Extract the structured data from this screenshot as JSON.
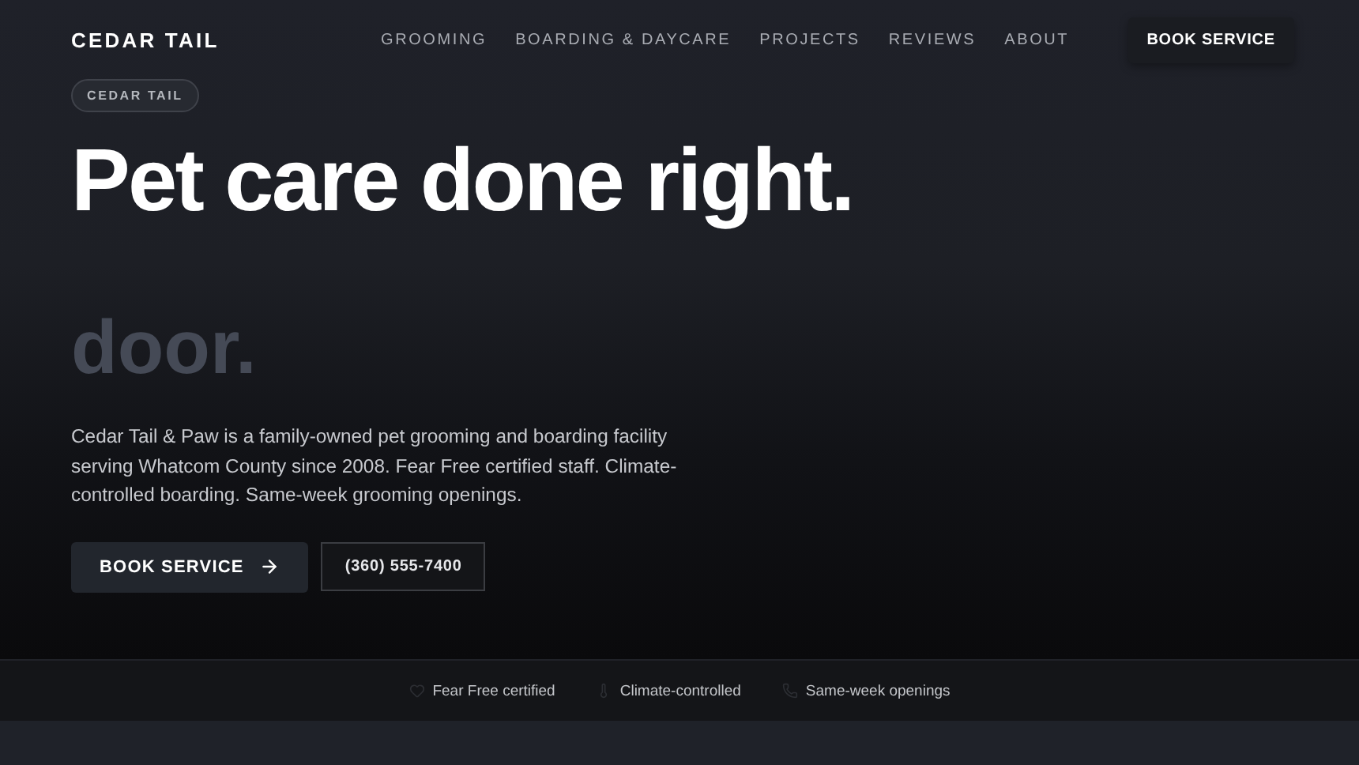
{
  "header": {
    "brand": "CEDAR TAIL",
    "nav": [
      {
        "label": "GROOMING"
      },
      {
        "label": "BOARDING & DAYCARE"
      },
      {
        "label": "PROJECTS"
      },
      {
        "label": "REVIEWS"
      },
      {
        "label": "ABOUT"
      }
    ],
    "cta": "BOOK SERVICE"
  },
  "hero": {
    "badge": "CEDAR TAIL",
    "headline": "Pet care done right.",
    "faded_text": "door.",
    "description": "Cedar Tail & Paw is a family-owned pet grooming and boarding facility serving Whatcom County since 2008. Fear Free certified staff. Climate-controlled boarding. Same-week grooming openings.",
    "primary_button": "BOOK SERVICE",
    "phone_button": "(360) 555-7400"
  },
  "features": [
    {
      "kind": "heart",
      "label": "Fear Free certified"
    },
    {
      "kind": "thermometer",
      "label": "Climate-controlled"
    },
    {
      "kind": "phone",
      "label": "Same-week openings"
    }
  ]
}
